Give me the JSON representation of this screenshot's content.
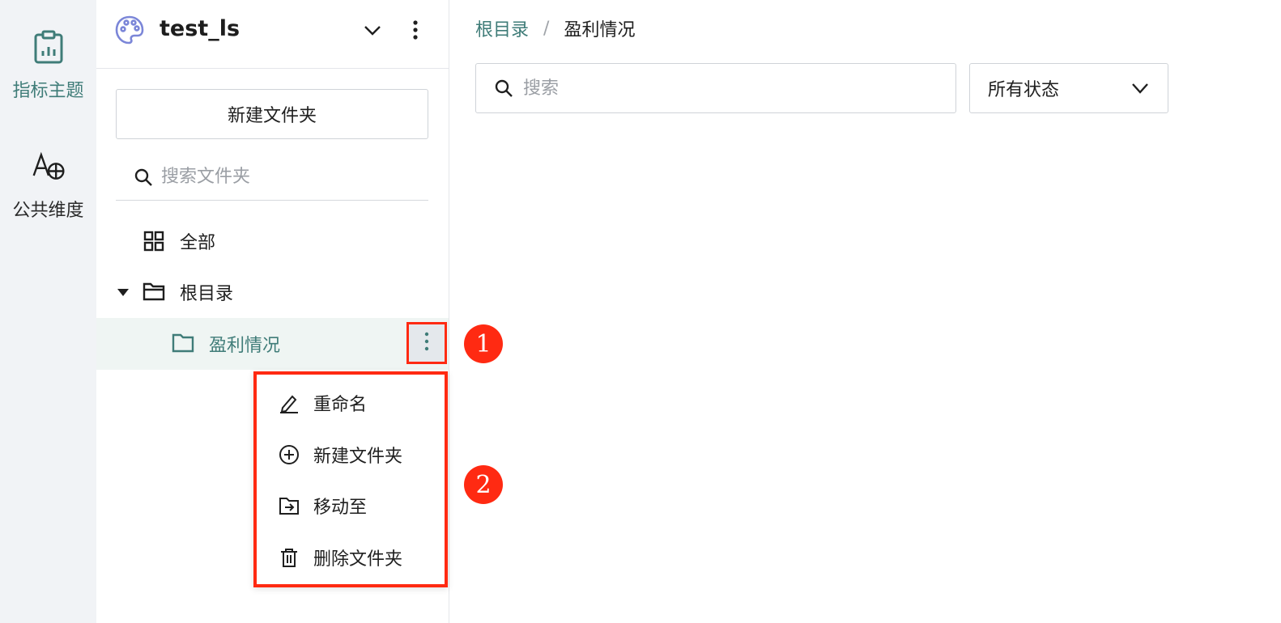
{
  "rail": {
    "items": [
      {
        "label": "指标主题",
        "icon": "clipboard-chart-icon",
        "active": true
      },
      {
        "label": "公共维度",
        "icon": "text-globe-icon",
        "active": false
      }
    ]
  },
  "panel": {
    "project_name": "test_ls",
    "new_folder_label": "新建文件夹",
    "search_placeholder": "搜索文件夹",
    "tree": {
      "all_label": "全部",
      "root_label": "根目录",
      "child_label": "盈利情况"
    }
  },
  "context_menu": {
    "items": [
      {
        "label": "重命名",
        "icon": "pencil-icon"
      },
      {
        "label": "新建文件夹",
        "icon": "plus-circle-icon"
      },
      {
        "label": "移动至",
        "icon": "folder-move-icon"
      },
      {
        "label": "删除文件夹",
        "icon": "trash-icon"
      }
    ]
  },
  "callouts": {
    "one": "1",
    "two": "2"
  },
  "main": {
    "breadcrumb": {
      "root": "根目录",
      "separator": "/",
      "current": "盈利情况"
    },
    "search_placeholder": "搜索",
    "status_filter": "所有状态"
  },
  "colors": {
    "accent": "#3f7c78",
    "highlight_red": "#ff2a12",
    "rail_bg": "#f1f3f6",
    "selected_row_bg": "#eff5f3"
  }
}
